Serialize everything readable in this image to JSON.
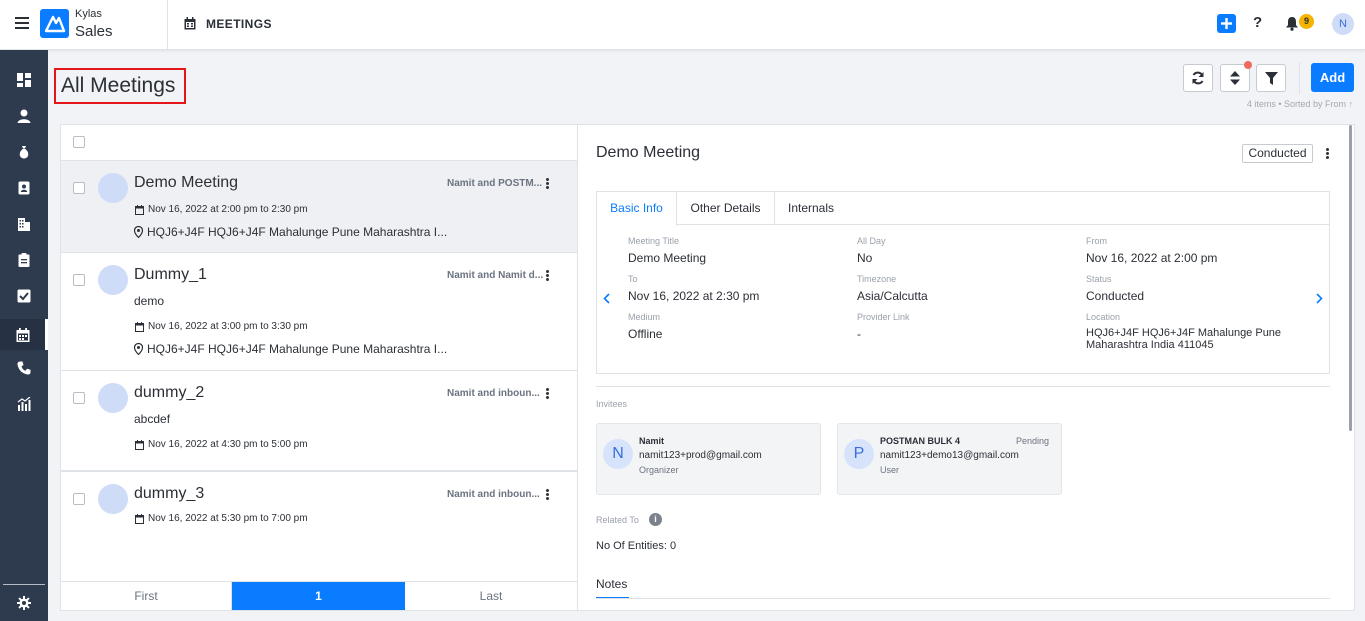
{
  "topbar": {
    "brand_top": "Kylas",
    "brand_bottom": "Sales",
    "section": "MEETINGS",
    "notification_count": "9",
    "user_initial": "N"
  },
  "page": {
    "title": "All Meetings",
    "add_label": "Add",
    "sort_info": "4 items • Sorted by From ↑"
  },
  "list": {
    "items": [
      {
        "title": "Demo Meeting",
        "who": "Namit and POSTM...",
        "desc": "",
        "when": "Nov 16, 2022 at 2:00 pm to 2:30 pm",
        "location": "HQJ6+J4F HQJ6+J4F Mahalunge Pune Maharashtra I..."
      },
      {
        "title": "Dummy_1",
        "who": "Namit and Namit d...",
        "desc": "demo",
        "when": "Nov 16, 2022 at 3:00 pm to 3:30 pm",
        "location": "HQJ6+J4F HQJ6+J4F Mahalunge Pune Maharashtra I..."
      },
      {
        "title": "dummy_2",
        "who": "Namit and inboun...",
        "desc": "abcdef",
        "when": "Nov 16, 2022 at 4:30 pm to 5:00 pm",
        "location": ""
      },
      {
        "title": "dummy_3",
        "who": "Namit and inboun...",
        "desc": "",
        "when": "Nov 16, 2022 at 5:30 pm to 7:00 pm",
        "location": ""
      }
    ],
    "pagination": {
      "first": "First",
      "current": "1",
      "last": "Last"
    }
  },
  "detail": {
    "title": "Demo Meeting",
    "status_badge": "Conducted",
    "tabs": [
      "Basic Info",
      "Other Details",
      "Internals"
    ],
    "fields": {
      "meeting_title_label": "Meeting Title",
      "meeting_title": "Demo Meeting",
      "all_day_label": "All Day",
      "all_day": "No",
      "from_label": "From",
      "from": "Nov 16, 2022 at 2:00 pm",
      "to_label": "To",
      "to": "Nov 16, 2022 at 2:30 pm",
      "timezone_label": "Timezone",
      "timezone": "Asia/Calcutta",
      "status_label": "Status",
      "status": "Conducted",
      "medium_label": "Medium",
      "medium": "Offline",
      "provider_link_label": "Provider Link",
      "provider_link": "-",
      "location_label": "Location",
      "location_line1": "HQJ6+J4F HQJ6+J4F Mahalunge Pune",
      "location_line2": "Maharashtra India 411045"
    },
    "invitees_label": "Invitees",
    "invitees": [
      {
        "initial": "N",
        "name": "Namit",
        "email": "namit123+prod@gmail.com",
        "role": "Organizer",
        "status": ""
      },
      {
        "initial": "P",
        "name": "POSTMAN BULK 4",
        "email": "namit123+demo13@gmail.com",
        "role": "User",
        "status": "Pending"
      }
    ],
    "related_to_label": "Related To",
    "entities": "No Of Entities: 0",
    "notes_label": "Notes"
  },
  "colors": {
    "accent": "#0a7cff",
    "sidebar": "#2e3a4d",
    "highlight_border": "#e5161b"
  }
}
